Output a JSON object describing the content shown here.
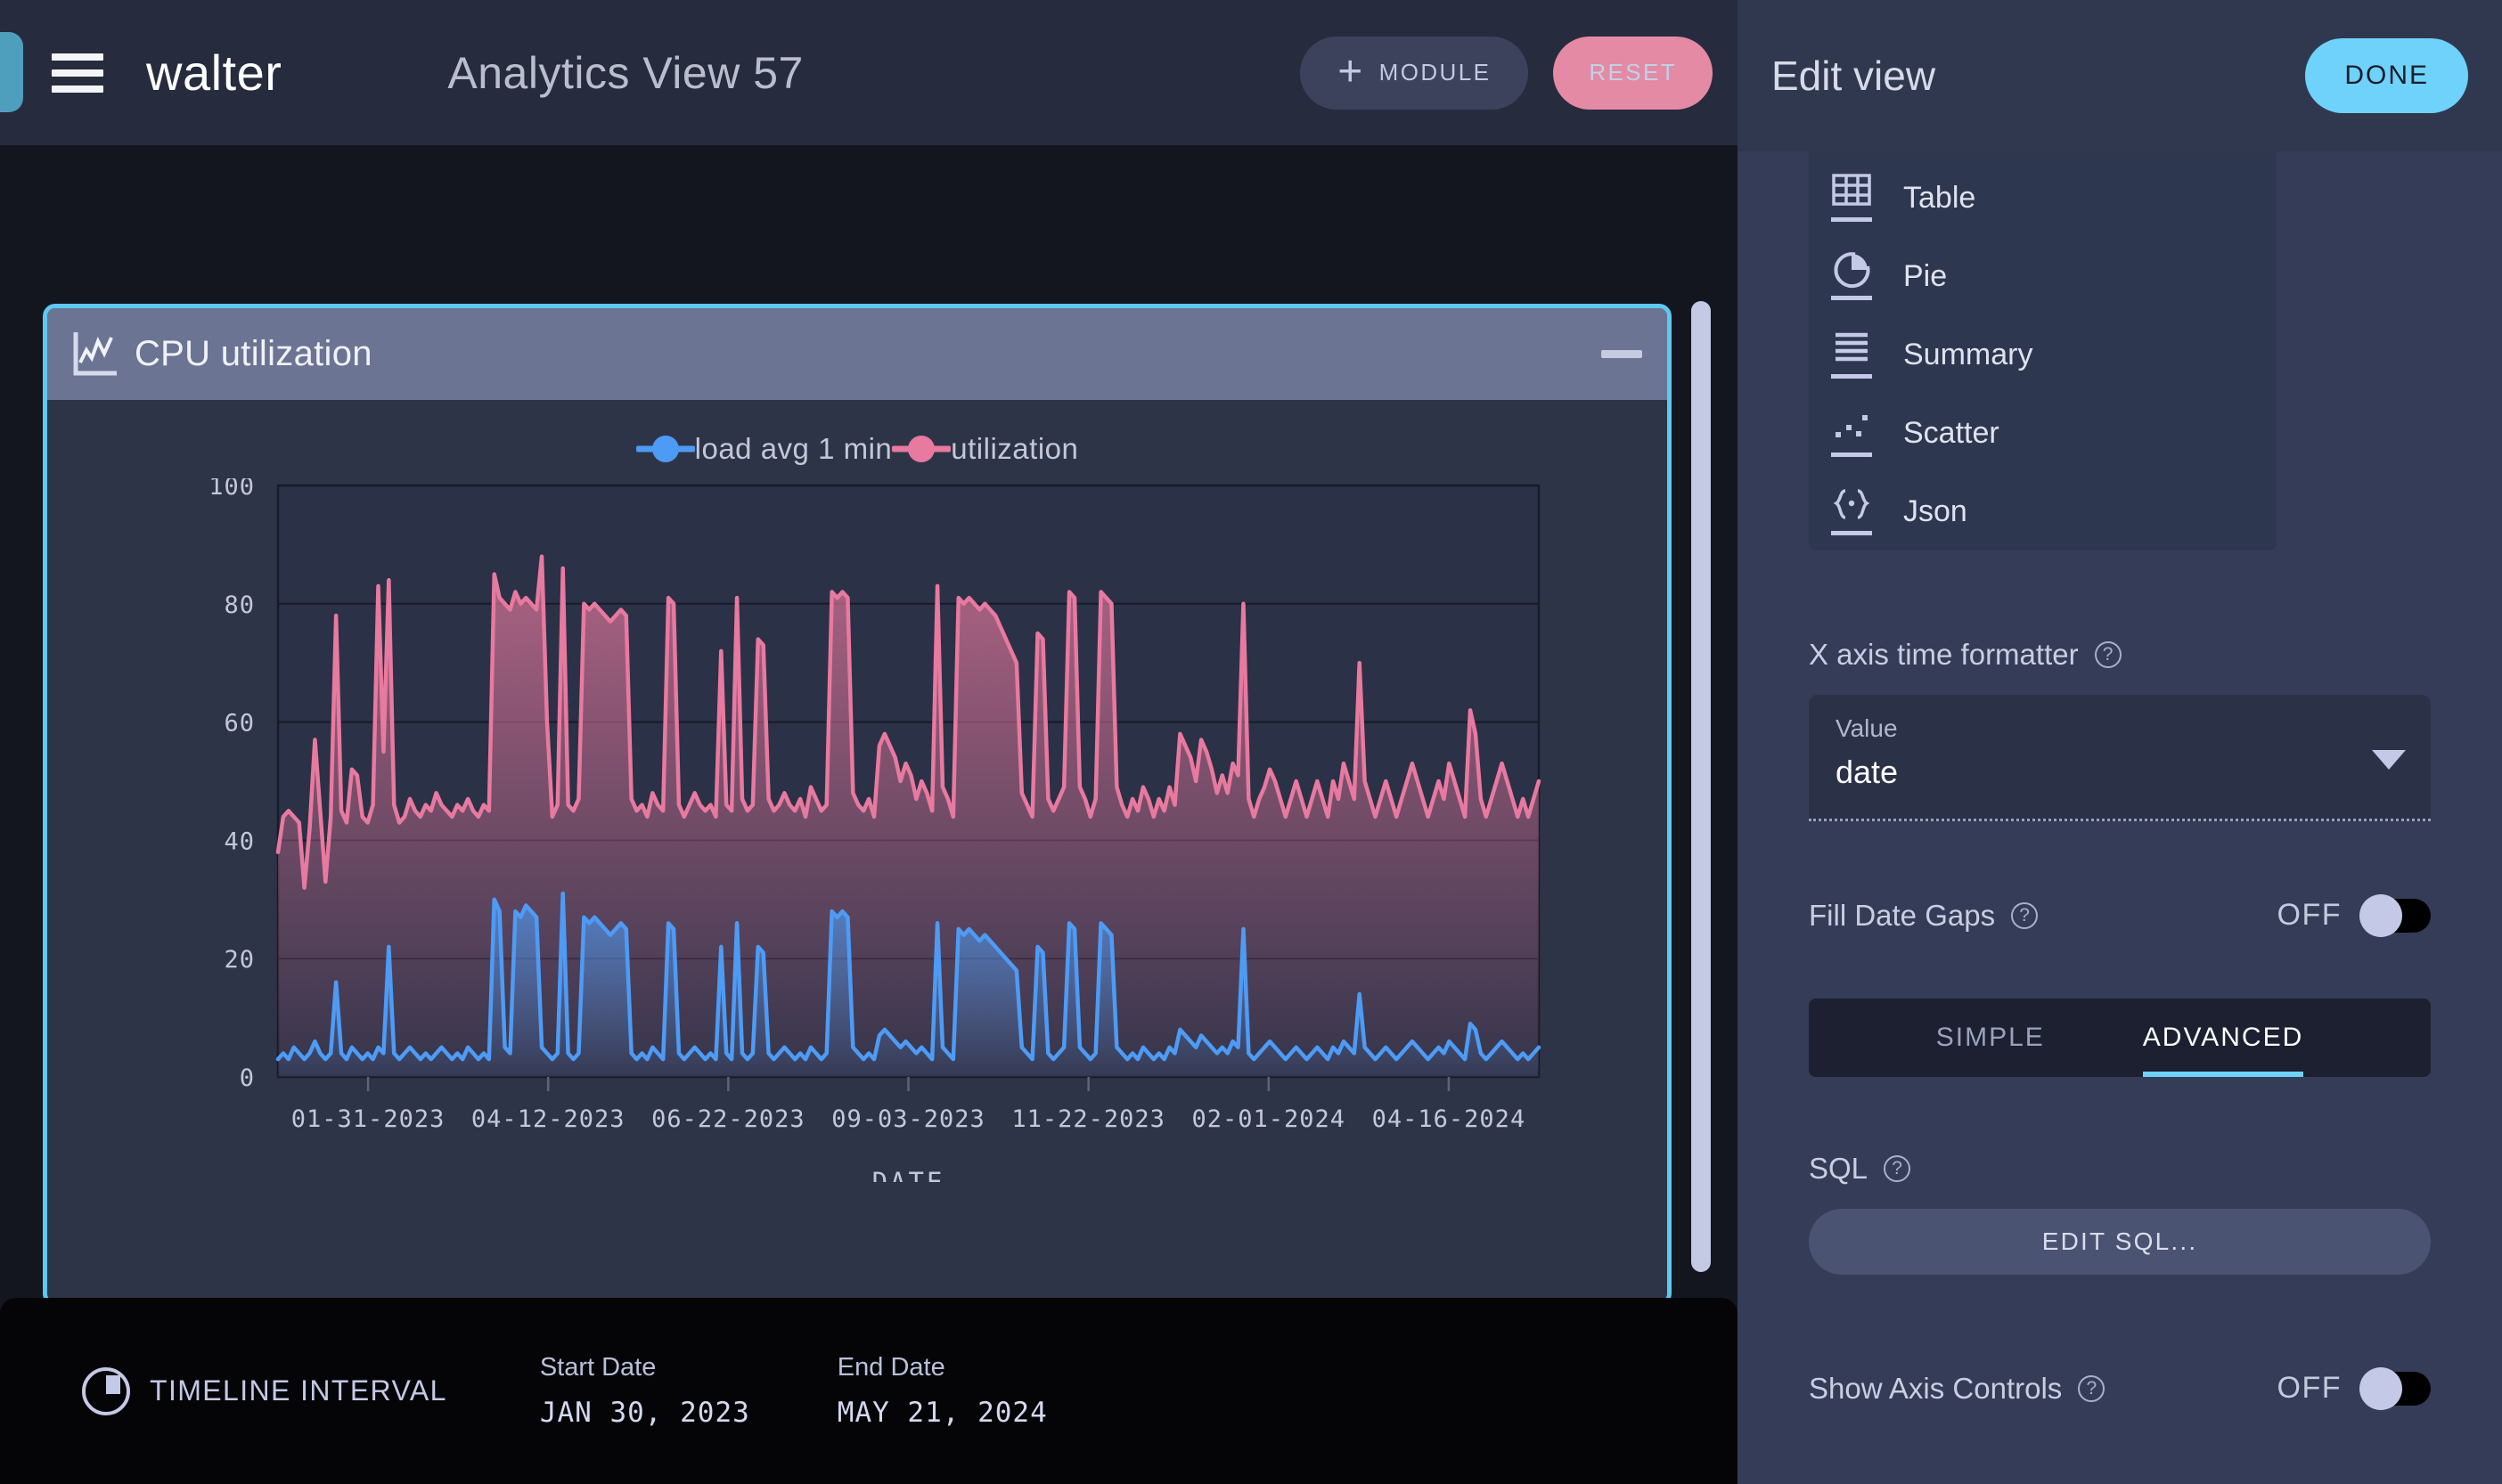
{
  "topbar": {
    "brand": "walter",
    "view_title": "Analytics View 57",
    "module_button": "MODULE",
    "module_icon": "plus-icon",
    "reset_button": "RESET",
    "menu_icon": "hamburger-menu-icon"
  },
  "card": {
    "title": "CPU utilization",
    "icon": "line-chart-icon",
    "minimize_icon": "minimize-icon",
    "accent_color": "#5dc8f0",
    "header_bg": "#6b7493",
    "body_bg": "#2e3447"
  },
  "chart_data": {
    "type": "area",
    "title": "CPU utilization",
    "xlabel": "DATE",
    "ylabel": "",
    "ylim": [
      0,
      100
    ],
    "yticks": [
      0,
      20,
      40,
      60,
      80,
      100
    ],
    "grid": true,
    "legend_position": "top-center",
    "xticks": [
      "01-31-2023",
      "04-12-2023",
      "06-22-2023",
      "09-03-2023",
      "11-22-2023",
      "02-01-2024",
      "04-16-2024"
    ],
    "series": [
      {
        "name": "load avg 1 min",
        "color": "#4d9bf5",
        "values": [
          3,
          4,
          3,
          5,
          4,
          3,
          4,
          6,
          4,
          3,
          4,
          16,
          4,
          3,
          5,
          4,
          3,
          4,
          3,
          5,
          4,
          22,
          4,
          3,
          4,
          5,
          4,
          3,
          4,
          3,
          4,
          5,
          4,
          3,
          4,
          3,
          5,
          4,
          3,
          4,
          3,
          30,
          28,
          5,
          4,
          28,
          27,
          29,
          28,
          27,
          5,
          4,
          3,
          4,
          31,
          4,
          3,
          4,
          27,
          26,
          27,
          26,
          25,
          24,
          25,
          26,
          25,
          4,
          3,
          4,
          3,
          5,
          4,
          3,
          26,
          25,
          4,
          3,
          4,
          5,
          4,
          3,
          4,
          3,
          22,
          4,
          3,
          26,
          4,
          3,
          4,
          22,
          21,
          4,
          3,
          4,
          5,
          4,
          3,
          4,
          3,
          5,
          4,
          3,
          4,
          28,
          27,
          28,
          27,
          5,
          4,
          3,
          4,
          3,
          7,
          8,
          7,
          6,
          5,
          6,
          5,
          4,
          5,
          4,
          3,
          26,
          5,
          4,
          3,
          25,
          24,
          25,
          24,
          23,
          24,
          23,
          22,
          21,
          20,
          19,
          18,
          5,
          4,
          3,
          22,
          21,
          4,
          3,
          4,
          5,
          26,
          25,
          5,
          4,
          3,
          4,
          26,
          25,
          24,
          5,
          4,
          3,
          4,
          3,
          5,
          4,
          3,
          4,
          3,
          5,
          4,
          8,
          7,
          6,
          5,
          7,
          6,
          5,
          4,
          5,
          4,
          6,
          5,
          25,
          4,
          3,
          4,
          5,
          6,
          5,
          4,
          3,
          4,
          5,
          4,
          3,
          4,
          5,
          4,
          3,
          5,
          4,
          6,
          5,
          4,
          14,
          5,
          4,
          3,
          4,
          5,
          4,
          3,
          4,
          5,
          6,
          5,
          4,
          3,
          4,
          5,
          4,
          6,
          5,
          4,
          3,
          9,
          8,
          4,
          3,
          4,
          5,
          6,
          5,
          4,
          3,
          4,
          3,
          4,
          5
        ]
      },
      {
        "name": "utilization",
        "color": "#e8799f",
        "values": [
          38,
          44,
          45,
          44,
          43,
          32,
          42,
          57,
          45,
          33,
          44,
          78,
          45,
          43,
          52,
          51,
          44,
          43,
          46,
          83,
          55,
          84,
          46,
          43,
          44,
          47,
          45,
          44,
          46,
          45,
          48,
          46,
          45,
          44,
          46,
          45,
          47,
          45,
          44,
          46,
          45,
          85,
          81,
          80,
          79,
          82,
          80,
          81,
          80,
          79,
          88,
          60,
          44,
          46,
          86,
          46,
          45,
          47,
          80,
          79,
          80,
          79,
          78,
          77,
          78,
          79,
          78,
          47,
          45,
          46,
          44,
          48,
          46,
          45,
          81,
          80,
          46,
          44,
          46,
          48,
          46,
          45,
          46,
          44,
          72,
          46,
          45,
          81,
          47,
          45,
          46,
          74,
          73,
          47,
          45,
          46,
          48,
          46,
          45,
          47,
          44,
          49,
          47,
          45,
          46,
          82,
          81,
          82,
          81,
          48,
          46,
          45,
          47,
          44,
          56,
          58,
          56,
          54,
          50,
          53,
          51,
          47,
          50,
          48,
          45,
          83,
          49,
          47,
          44,
          81,
          80,
          81,
          80,
          79,
          80,
          79,
          78,
          76,
          74,
          72,
          70,
          48,
          46,
          44,
          75,
          74,
          47,
          45,
          47,
          49,
          82,
          81,
          49,
          47,
          44,
          47,
          82,
          81,
          80,
          49,
          46,
          44,
          47,
          45,
          49,
          47,
          44,
          47,
          45,
          49,
          46,
          58,
          56,
          54,
          50,
          57,
          55,
          52,
          48,
          51,
          48,
          53,
          51,
          80,
          47,
          44,
          47,
          49,
          52,
          50,
          47,
          44,
          47,
          50,
          47,
          44,
          47,
          50,
          47,
          44,
          50,
          47,
          53,
          50,
          47,
          70,
          50,
          47,
          44,
          47,
          50,
          47,
          44,
          47,
          50,
          53,
          50,
          47,
          44,
          47,
          50,
          47,
          53,
          50,
          47,
          44,
          62,
          58,
          47,
          44,
          47,
          50,
          53,
          50,
          47,
          44,
          47,
          44,
          47,
          50
        ]
      }
    ]
  },
  "footer": {
    "timeline_icon": "clock-icon",
    "timeline_label": "TIMELINE INTERVAL",
    "start_caption": "Start Date",
    "start_value": "JAN 30, 2023",
    "end_caption": "End Date",
    "end_value": "MAY 21, 2024"
  },
  "panel": {
    "title": "Edit view",
    "done_button": "DONE",
    "accent_color": "#6fd2fa",
    "view_types": [
      {
        "label": "Table",
        "icon": "table-icon"
      },
      {
        "label": "Pie",
        "icon": "pie-chart-icon"
      },
      {
        "label": "Summary",
        "icon": "summary-lines-icon"
      },
      {
        "label": "Scatter",
        "icon": "scatter-plot-icon"
      },
      {
        "label": "Json",
        "icon": "json-braces-icon"
      }
    ],
    "x_axis_formatter": {
      "label": "X axis time formatter",
      "help_icon": "help-icon",
      "caption": "Value",
      "value": "date",
      "dropdown_icon": "chevron-down-icon"
    },
    "fill_date_gaps": {
      "label": "Fill Date Gaps",
      "help_icon": "help-icon",
      "state": "OFF"
    },
    "tabs": [
      {
        "label": "SIMPLE",
        "active": false
      },
      {
        "label": "ADVANCED",
        "active": true
      }
    ],
    "sql": {
      "label": "SQL",
      "help_icon": "help-icon",
      "button": "EDIT SQL..."
    },
    "show_axis_controls": {
      "label": "Show Axis Controls",
      "help_icon": "help-icon",
      "state": "OFF"
    }
  }
}
